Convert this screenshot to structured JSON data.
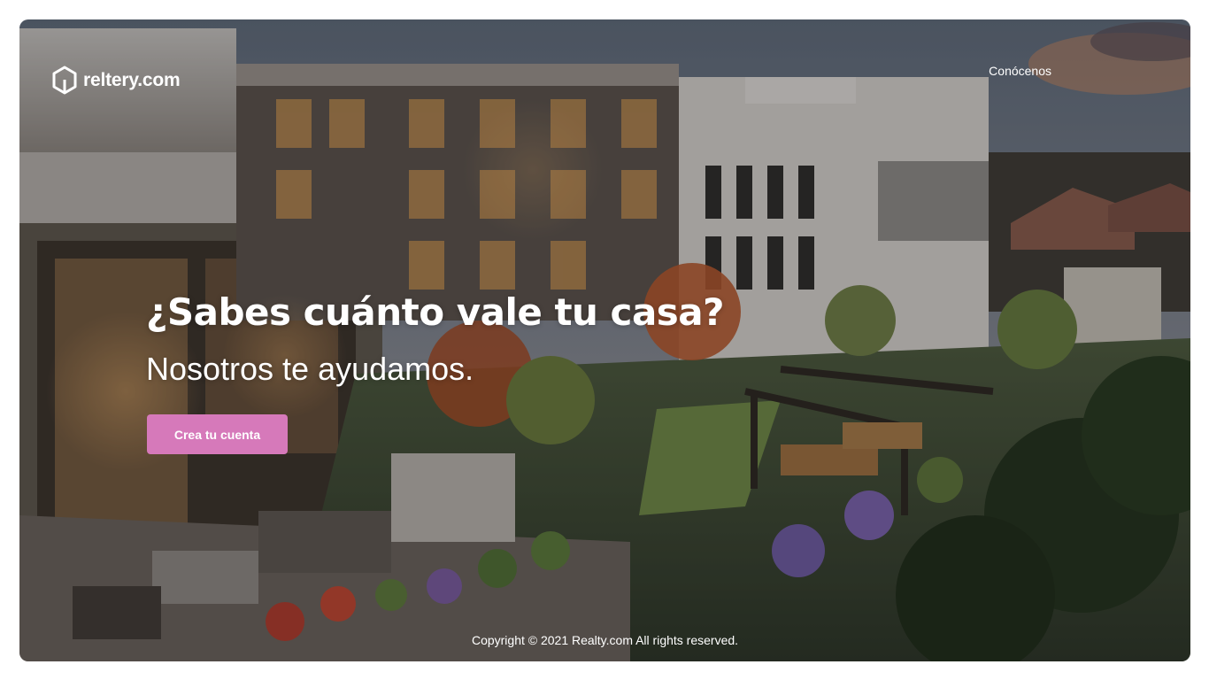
{
  "header": {
    "logo_text": "reltery.com",
    "nav": [
      {
        "label": "Conócenos"
      }
    ]
  },
  "hero": {
    "title": "¿Sabes cuánto vale tu casa?",
    "subtitle": "Nosotros te ayudamos.",
    "cta_label": "Crea tu cuenta"
  },
  "footer": {
    "copyright": "Copyright © 2021 Realty.com All rights reserved."
  },
  "colors": {
    "cta_background": "#d679ba",
    "text": "#ffffff"
  }
}
